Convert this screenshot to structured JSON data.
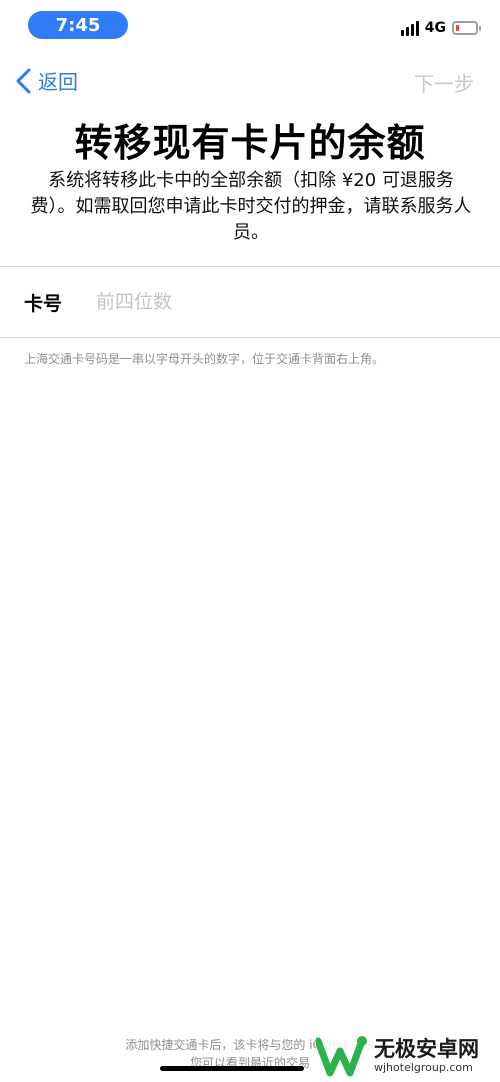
{
  "status_bar": {
    "time": "7:45",
    "network": "4G"
  },
  "nav": {
    "back_label": "返回",
    "next_label": "下一步"
  },
  "title": "转移现有卡片的余额",
  "description": "系统将转移此卡中的全部余额（扣除 ¥20 可退服务费）。如需取回您申请此卡时交付的押金，请联系服务人员。",
  "card_field": {
    "label": "卡号",
    "placeholder": "前四位数",
    "value": ""
  },
  "hint": "上海交通卡号码是一串以字母开头的数字，位于交通卡背面右上角。",
  "footer": {
    "line1": "添加快捷交通卡后，该卡将与您的 iCloud 关联",
    "line2": "您可以看到最近的交易"
  },
  "watermark": {
    "title": "无极安卓网",
    "url": "wjhotelgroup.com"
  },
  "colors": {
    "accent": "#2b7bf6",
    "time_pill": "#2f7cf6",
    "disabled": "#c8c8c8",
    "secondary_text": "#8e8e8e",
    "battery_low": "#ff3333",
    "watermark_green": "#2bb34a"
  }
}
